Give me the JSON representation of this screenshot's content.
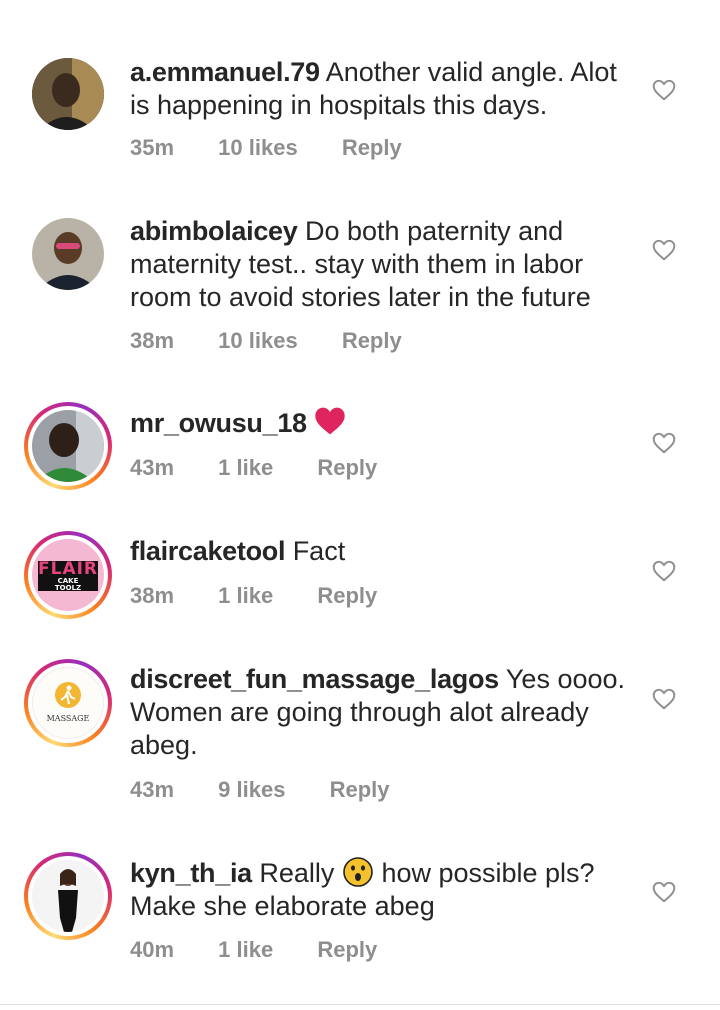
{
  "comments": [
    {
      "username": "a.emmanuel.79",
      "text": "Another valid angle. Alot is happening in hospitals this days.",
      "time": "35m",
      "likes": "10 likes",
      "reply": "Reply"
    },
    {
      "username": "abimbolaicey",
      "text": "Do both paternity and maternity test.. stay with them in labor room to avoid stories later in the future",
      "time": "38m",
      "likes": "10 likes",
      "reply": "Reply"
    },
    {
      "username": "mr_owusu_18",
      "text": "",
      "time": "43m",
      "likes": "1 like",
      "reply": "Reply"
    },
    {
      "username": "flaircaketool",
      "text": "Fact",
      "time": "38m",
      "likes": "1 like",
      "reply": "Reply"
    },
    {
      "username": "discreet_fun_massage_lagos",
      "text": "Yes oooo. Women are going through alot already abeg.",
      "time": "43m",
      "likes": "9 likes",
      "reply": "Reply"
    },
    {
      "username": "kyn_th_ia",
      "text_before": "Really",
      "text_after": "how possible pls? Make she elaborate abeg",
      "time": "40m",
      "likes": "1 like",
      "reply": "Reply"
    }
  ],
  "avatar_logos": {
    "flair": {
      "line1": "FLAIR",
      "line2": "CAKE",
      "line3": "TOOLZ"
    },
    "massage": {
      "label": "MASSAGE"
    }
  },
  "icons": {
    "like": "heart-outline-icon",
    "red_heart": "red-heart-emoji",
    "surprised": "astonished-face-emoji"
  },
  "colors": {
    "text": "#262626",
    "meta": "#8e8e8e",
    "heart_emoji": "#e0245e",
    "story_ring_start": "#feda75",
    "story_ring_end": "#962fbf"
  }
}
